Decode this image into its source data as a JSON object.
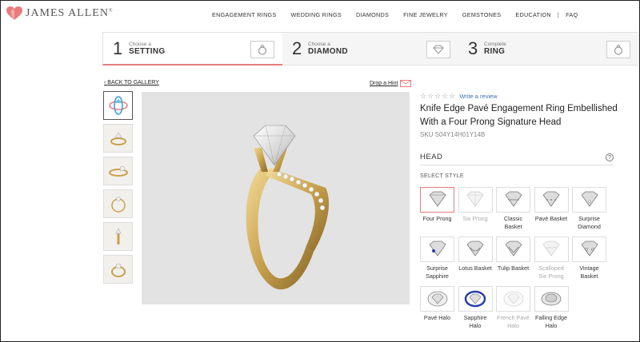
{
  "brand": {
    "name": "JAMES ALLEN",
    "mark": "®"
  },
  "nav": [
    "ENGAGEMENT RINGS",
    "WEDDING RINGS",
    "DIAMONDS",
    "FINE JEWELRY",
    "GEMSTONES",
    "EDUCATION",
    "|",
    "FAQ"
  ],
  "steps": [
    {
      "num": "1",
      "sub": "Choose a",
      "main": "SETTING",
      "icon": "ring-icon"
    },
    {
      "num": "2",
      "sub": "Choose a",
      "main": "DIAMOND",
      "icon": "diamond-icon"
    },
    {
      "num": "3",
      "sub": "Complete",
      "main": "RING",
      "icon": "ring-icon"
    }
  ],
  "gallery": {
    "back": "BACK TO GALLERY",
    "hint": "Drop a Hint"
  },
  "product": {
    "stars": "☆☆☆☆☆",
    "review": "Write a review",
    "title": "Knife Edge Pavé Engagement Ring Embellished With a Four Prong Signature Head",
    "sku": "SKU S04Y14H01Y14B"
  },
  "head": {
    "label": "HEAD",
    "select": "SELECT STYLE",
    "options": [
      {
        "label": "Four Prong"
      },
      {
        "label": "Six Prong"
      },
      {
        "label": "Classic Basket"
      },
      {
        "label": "Pavé Basket"
      },
      {
        "label": "Surprise Diamond"
      },
      {
        "label": "Surprise Sapphire"
      },
      {
        "label": "Lotus Basket"
      },
      {
        "label": "Tulip Basket"
      },
      {
        "label": "Scalloped Six Prong"
      },
      {
        "label": "Vintage Basket"
      },
      {
        "label": "Pavé Halo"
      },
      {
        "label": "Sapphire Halo"
      },
      {
        "label": "French Pavé Halo"
      },
      {
        "label": "Falling Edge Halo"
      }
    ]
  },
  "colors": {
    "accent": "#e87c7c",
    "link": "#3b6fb5",
    "gold": "#d4b15a",
    "sapphire": "#2a3fa8"
  }
}
